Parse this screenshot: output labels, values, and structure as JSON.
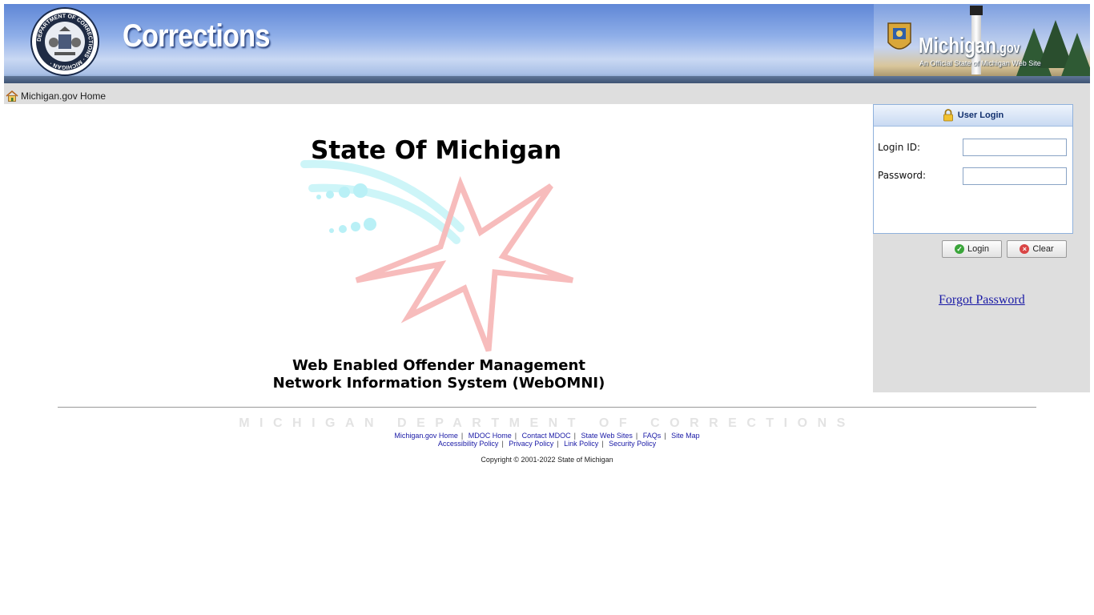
{
  "header": {
    "seal_text": "DEPARTMENT OF CORRECTIONS · MICHIGAN ·",
    "title": "Corrections",
    "brand_name": "Michigan",
    "brand_suffix": ".gov",
    "brand_tagline": "An Official State of Michigan Web Site"
  },
  "nav": {
    "home_link": "Michigan.gov Home"
  },
  "main": {
    "title": "State Of Michigan",
    "subtitle_line1": "Web Enabled Offender Management",
    "subtitle_line2": "Network Information System (WebOMNI)"
  },
  "login": {
    "header": "User Login",
    "login_id_label": "Login ID:",
    "login_id_value": "",
    "password_label": "Password:",
    "password_value": "",
    "login_button": "Login",
    "clear_button": "Clear",
    "forgot_password": "Forgot Password"
  },
  "footer": {
    "department": "MICHIGAN DEPARTMENT OF CORRECTIONS",
    "links_row1": [
      "Michigan.gov Home",
      "MDOC Home",
      "Contact MDOC",
      "State Web Sites",
      "FAQs",
      "Site Map"
    ],
    "links_row2": [
      "Accessibility Policy",
      "Privacy Policy",
      "Link Policy",
      "Security Policy"
    ],
    "copyright": "Copyright © 2001-2022 State of Michigan"
  },
  "colors": {
    "banner_blue": "#6f95dd",
    "link_blue": "#1a1aa6",
    "panel_gray": "#dedede",
    "login_border": "#8fb1dc"
  },
  "icons": {
    "home": "house-icon",
    "lock": "padlock-icon",
    "login": "green-check-icon",
    "clear": "red-x-icon"
  }
}
